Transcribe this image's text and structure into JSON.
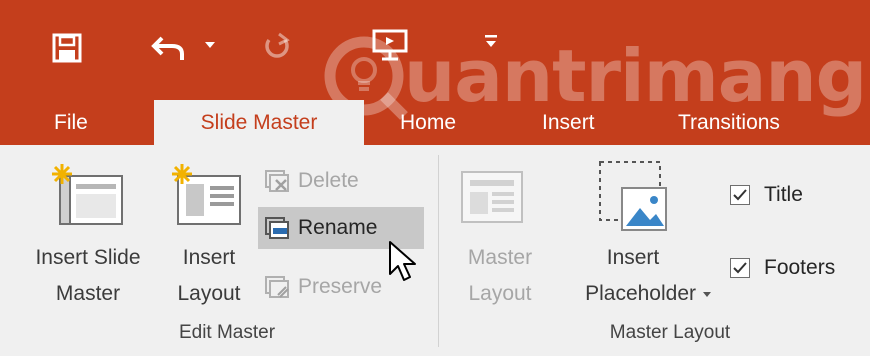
{
  "watermark": {
    "text": "uantrimang"
  },
  "tabs": [
    {
      "label": "File",
      "active": false
    },
    {
      "label": "Slide Master",
      "active": true
    },
    {
      "label": "Home",
      "active": false
    },
    {
      "label": "Insert",
      "active": false
    },
    {
      "label": "Transitions",
      "active": false
    }
  ],
  "quick_access": {
    "icons": [
      "save-icon",
      "undo-icon",
      "undo-dropdown-icon",
      "redo-icon",
      "start-from-beginning-icon",
      "customize-toolbar-icon"
    ]
  },
  "edit_master": {
    "insert_slide_master": {
      "line1": "Insert Slide",
      "line2": "Master"
    },
    "insert_layout": {
      "line1": "Insert",
      "line2": "Layout"
    },
    "delete_label": "Delete",
    "rename_label": "Rename",
    "preserve_label": "Preserve",
    "group_label": "Edit Master"
  },
  "master_layout": {
    "master_layout_btn": {
      "line1": "Master",
      "line2": "Layout"
    },
    "insert_placeholder": {
      "line1": "Insert",
      "line2": "Placeholder"
    },
    "title_label": "Title",
    "title_checked": true,
    "footers_label": "Footers",
    "footers_checked": true,
    "group_label": "Master Layout"
  },
  "colors": {
    "title_bar": "#c43e1c",
    "ribbon_bg": "#f0f0f0",
    "hover_bg": "#c8c8c8",
    "disabled_text": "#a6a6a6"
  }
}
